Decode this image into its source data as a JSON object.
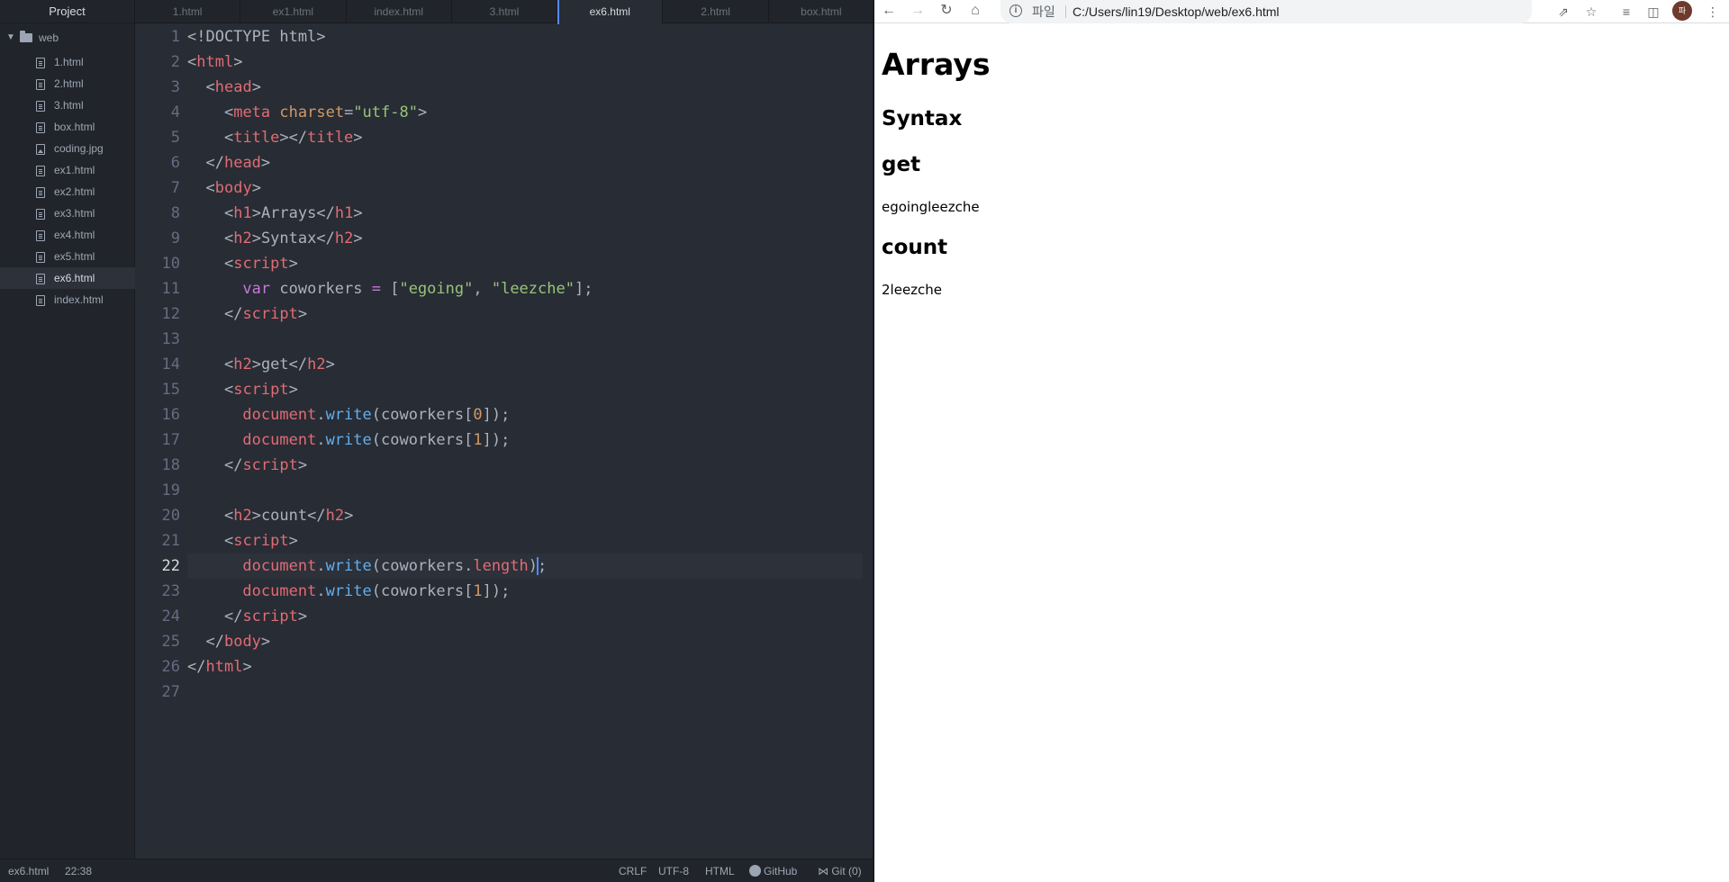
{
  "sidebar": {
    "title": "Project",
    "root": "web",
    "files": [
      {
        "name": "1.html",
        "type": "file"
      },
      {
        "name": "2.html",
        "type": "file"
      },
      {
        "name": "3.html",
        "type": "file"
      },
      {
        "name": "box.html",
        "type": "file"
      },
      {
        "name": "coding.jpg",
        "type": "image"
      },
      {
        "name": "ex1.html",
        "type": "file"
      },
      {
        "name": "ex2.html",
        "type": "file"
      },
      {
        "name": "ex3.html",
        "type": "file"
      },
      {
        "name": "ex4.html",
        "type": "file"
      },
      {
        "name": "ex5.html",
        "type": "file"
      },
      {
        "name": "ex6.html",
        "type": "file",
        "selected": true
      },
      {
        "name": "index.html",
        "type": "file"
      }
    ]
  },
  "tabs": [
    {
      "label": "1.html"
    },
    {
      "label": "ex1.html"
    },
    {
      "label": "index.html"
    },
    {
      "label": "3.html"
    },
    {
      "label": "ex6.html",
      "active": true
    },
    {
      "label": "2.html"
    },
    {
      "label": "box.html"
    }
  ],
  "editor": {
    "current_line": 22,
    "line_numbers": [
      "1",
      "2",
      "3",
      "4",
      "5",
      "6",
      "7",
      "8",
      "9",
      "10",
      "11",
      "12",
      "13",
      "14",
      "15",
      "16",
      "17",
      "18",
      "19",
      "20",
      "21",
      "22",
      "23",
      "24",
      "25",
      "26",
      "27"
    ]
  },
  "statusbar": {
    "file": "ex6.html",
    "cursor": "22:38",
    "line_ending": "CRLF",
    "encoding": "UTF-8",
    "grammar": "HTML",
    "github": "GitHub",
    "git": "Git (0)"
  },
  "browser": {
    "chip": "파일",
    "url": "C:/Users/lin19/Desktop/web/ex6.html",
    "avatar": "파",
    "page": {
      "h1": "Arrays",
      "h2_syntax": "Syntax",
      "h2_get": "get",
      "get_output": "egoingleezche",
      "h2_count": "count",
      "count_output": "2leezche"
    }
  },
  "colors": {
    "editor_bg": "#282c34",
    "tag": "#e06c75",
    "attr": "#d19a66",
    "string": "#98c379",
    "keyword": "#c678dd",
    "function": "#61afef",
    "accent": "#568af2"
  }
}
